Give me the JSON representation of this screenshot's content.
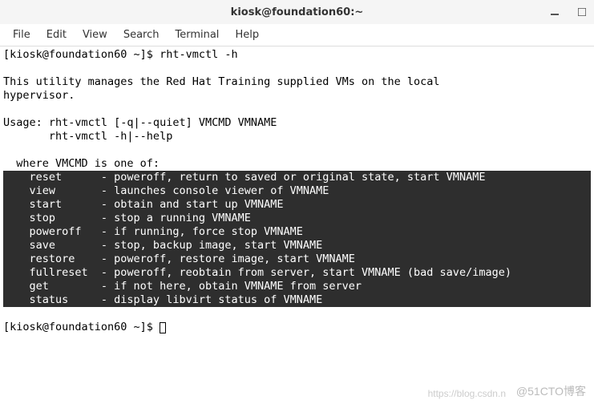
{
  "titlebar": {
    "title": "kiosk@foundation60:~"
  },
  "menubar": {
    "items": [
      "File",
      "Edit",
      "View",
      "Search",
      "Terminal",
      "Help"
    ]
  },
  "terminal": {
    "prompt1": "[kiosk@foundation60 ~]$ ",
    "cmd1": "rht-vmctl -h",
    "blank1": "",
    "desc_line1": "This utility manages the Red Hat Training supplied VMs on the local",
    "desc_line2": "hypervisor.",
    "blank2": "",
    "usage1": "Usage: rht-vmctl [-q|--quiet] VMCMD VMNAME",
    "usage2": "       rht-vmctl -h|--help",
    "blank3": "",
    "where": "  where VMCMD is one of:",
    "cmds": [
      "    reset      - poweroff, return to saved or original state, start VMNAME",
      "    view       - launches console viewer of VMNAME",
      "    start      - obtain and start up VMNAME",
      "    stop       - stop a running VMNAME",
      "    poweroff   - if running, force stop VMNAME",
      "    save       - stop, backup image, start VMNAME",
      "    restore    - poweroff, restore image, start VMNAME",
      "    fullreset  - poweroff, reobtain from server, start VMNAME (bad save/image)",
      "    get        - if not here, obtain VMNAME from server",
      "    status     - display libvirt status of VMNAME"
    ],
    "prompt2": "[kiosk@foundation60 ~]$ "
  },
  "watermark": {
    "left": "https://blog.csdn.n",
    "right": "@51CTO博客"
  }
}
